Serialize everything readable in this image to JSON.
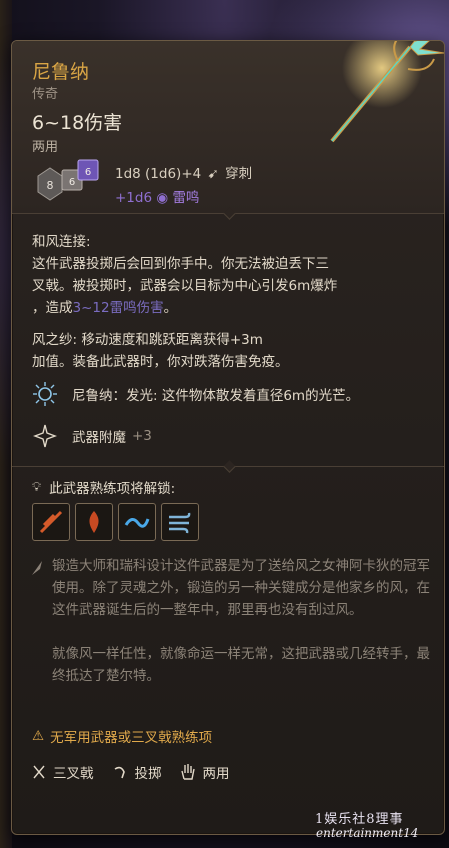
{
  "item": {
    "name": "尼鲁纳",
    "rarity": "传奇",
    "damage": "6~18伤害",
    "handedness": "两用",
    "roll_main": "1d8 (1d6)+4",
    "roll_type": "穿刺",
    "roll_extra": "+1d6",
    "roll_extra_type": "雷鸣",
    "dice": [
      "8",
      "6",
      "6"
    ]
  },
  "description": {
    "wind_heading": "和风连接:",
    "wind_line1": "这件武器投掷后会回到你手中。你无法被迫丢下三",
    "wind_line2": "叉戟。被投掷时，武器会以目标为中心引发6m爆炸",
    "wind_line3_pre": "，造成",
    "wind_line3_link": "3~12雷鸣伤害",
    "wind_line3_post": "。",
    "gauze_line1": "风之纱: 移动速度和跳跃距离获得+3m",
    "gauze_line2": "加值。装备此武器时，你对跌落伤害免疫。"
  },
  "abilities": [
    {
      "label": "尼鲁纳：发光: 这件物体散发着直径6m的光芒。",
      "icon": "glow-icon"
    },
    {
      "label": "武器附魔",
      "value": "+3",
      "icon": "enchant-icon"
    }
  ],
  "mastery": {
    "heading": "此武器熟练项将解锁:",
    "icons": [
      "slash-skill-icon",
      "flame-strike-icon",
      "wave-skill-icon",
      "wind-gust-icon"
    ]
  },
  "lore": {
    "paragraph1": "锻造大师和瑞科设计这件武器是为了送给风之女神阿卡狄的冠军使用。除了灵魂之外，锻造的另一种关键成分是他家乡的风，在这件武器诞生后的一整年中，那里再也没有刮过风。",
    "paragraph2": "就像风一样任性，就像命运一样无常，这把武器或几经转手，最终抵达了楚尔特。"
  },
  "warning": "无军用武器或三叉戟熟练项",
  "tags": [
    {
      "label": "三叉戟",
      "icon": "trident-icon"
    },
    {
      "label": "投掷",
      "icon": "throw-icon"
    },
    {
      "label": "两用",
      "icon": "hand-icon"
    }
  ],
  "watermark": {
    "line1": "1娱乐社8理事",
    "line2": "entertainment14"
  },
  "colors": {
    "title": "#d9a545",
    "thunder": "#8f6fd0",
    "warning": "#e0a94b",
    "lore": "#8c8378"
  }
}
